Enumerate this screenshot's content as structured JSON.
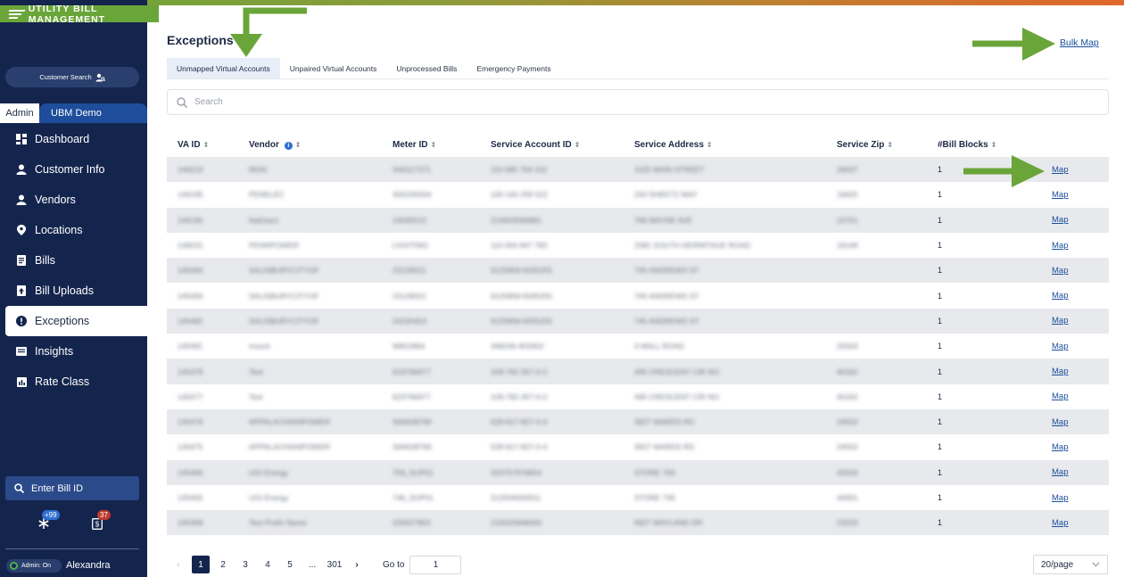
{
  "brand": {
    "title": "UTILITY BILL MANAGEMENT"
  },
  "sidebar": {
    "customer_search": "Customer Search",
    "tabs": {
      "admin": "Admin",
      "org": "UBM Demo"
    },
    "items": [
      {
        "label": "Dashboard",
        "icon": "dashboard-icon"
      },
      {
        "label": "Customer Info",
        "icon": "user-icon"
      },
      {
        "label": "Vendors",
        "icon": "user-icon"
      },
      {
        "label": "Locations",
        "icon": "location-pin-icon"
      },
      {
        "label": "Bills",
        "icon": "document-icon"
      },
      {
        "label": "Bill Uploads",
        "icon": "upload-icon"
      },
      {
        "label": "Exceptions",
        "icon": "exclamation-icon"
      },
      {
        "label": "Insights",
        "icon": "insights-icon"
      },
      {
        "label": "Rate Class",
        "icon": "bar-chart-icon"
      }
    ],
    "bill_search_placeholder": "Enter Bill ID",
    "badges": {
      "asterisk": "+99",
      "bills": "37"
    },
    "admin_toggle": "Admin: On",
    "user_name": "Alexandra"
  },
  "main": {
    "title": "Exceptions",
    "bulk_map": "Bulk Map",
    "tabs": [
      {
        "label": "Unmapped Virtual Accounts",
        "active": true
      },
      {
        "label": "Unpaired Virtual Accounts"
      },
      {
        "label": "Unprocessed Bills"
      },
      {
        "label": "Emergency Payments"
      }
    ],
    "search_placeholder": "Search",
    "table": {
      "columns": [
        "VA ID",
        "Vendor",
        "Meter ID",
        "Service Account ID",
        "Service Address",
        "Service Zip",
        "#Bill Blocks"
      ],
      "action_label": "Map",
      "rows": [
        [
          "146219",
          "MON",
          "S44117371",
          "110 085 704 102",
          "1025 MAIN STREET",
          "26037",
          "1"
        ],
        [
          "146195",
          "PENELEC",
          "S00230344",
          "100 140 259 522",
          "243 SHEETZ WAY",
          "16625",
          "1"
        ],
        [
          "146195",
          "NatGas1",
          "14030510",
          "210003590881",
          "768 WAYNE AVE",
          "15701",
          "1"
        ],
        [
          "146015",
          "PENNPOWER",
          "LIGHTING",
          "110 004 847 783",
          "2381 SOUTH HERMITAGE ROAD",
          "16148",
          "1"
        ],
        [
          "145494",
          "SALISBURYCITYOF",
          "23129021",
          "9125858-9335255",
          "745 ANDREWS ST",
          "",
          "1"
        ],
        [
          "145493",
          "SALISBURYCITYOF",
          "23129021",
          "9125858-9335255",
          "745 ANDREWS ST",
          "",
          "1"
        ],
        [
          "145492",
          "SALISBURYCITYOF",
          "24230453",
          "9125858-9335255",
          "745 ANDREWS ST",
          "",
          "1"
        ],
        [
          "145491",
          "mount",
          "W822864",
          "348166-403402",
          "4 MALL ROAD",
          "25504",
          "1"
        ],
        [
          "145478",
          "Test",
          "623766977",
          "109-782-357-0-2",
          "495 CRESCENT CIR NO",
          "40162",
          "1"
        ],
        [
          "145477",
          "Test",
          "623766977",
          "109-782-357-0-2",
          "495 CRESCENT CIR NO",
          "40162",
          "1"
        ],
        [
          "145476",
          "APPALACHIANPOWER",
          "S94508769",
          "028-917-827-0-4",
          "3927 WARDS RD",
          "24502",
          "1"
        ],
        [
          "145475",
          "APPALACHIANPOWER",
          "S94508769",
          "028-917-827-0-4",
          "3927 WARDS RD",
          "24502",
          "1"
        ],
        [
          "145406",
          "UGI Energy",
          "759_SUP01",
          "203757976654",
          "STORE 759",
          "43026",
          "1"
        ],
        [
          "145400",
          "UGI Energy",
          "746_SUP01",
          "212004500011",
          "STORE 746",
          "44001",
          "1"
        ],
        [
          "145399",
          "Test Prefix Name",
          "029327803",
          "210020948400",
          "9927 MAYLAND DR",
          "23233",
          "1"
        ]
      ]
    },
    "pagination": {
      "pages": [
        "1",
        "2",
        "3",
        "4",
        "5",
        "...",
        "301"
      ],
      "goto_label": "Go to",
      "goto_value": "1",
      "page_size": "20/page"
    }
  },
  "colors": {
    "brand_green": "#6aa53a",
    "sidebar_bg": "#14254d",
    "link": "#1a4f9c",
    "annotation_arrow": "#6aa53a"
  }
}
